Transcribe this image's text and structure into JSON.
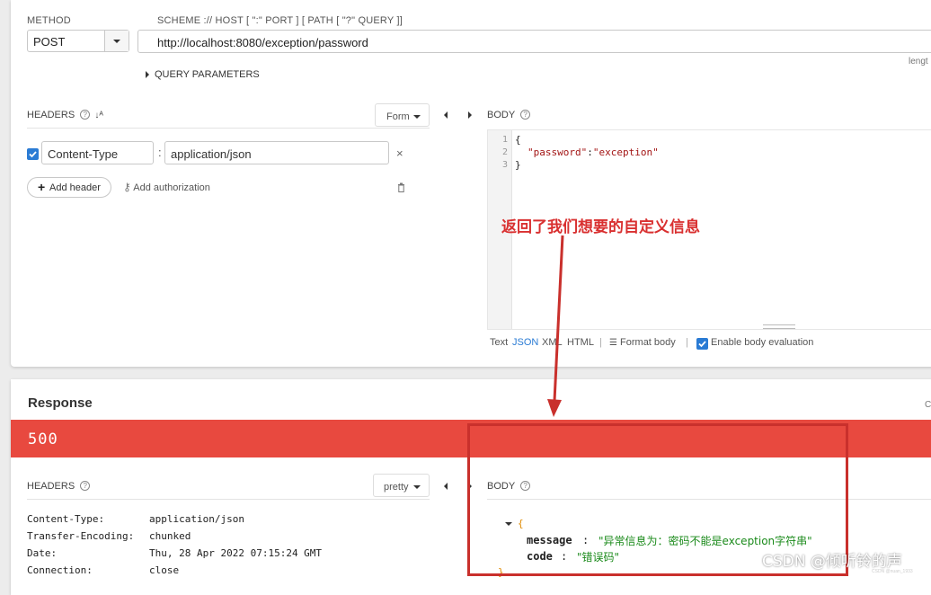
{
  "request": {
    "method_label": "METHOD",
    "method_value": "POST",
    "url_label": "SCHEME :// HOST [ \":\" PORT ] [ PATH [ \"?\" QUERY ]]",
    "url_value": "http://localhost:8080/exception/password",
    "length_label": "lengt",
    "query_parameters_label": "QUERY PARAMETERS",
    "headers_label": "HEADERS",
    "headers_mode": "Form",
    "header_rows": [
      {
        "name": "Content-Type",
        "value": "application/json",
        "enabled": true
      }
    ],
    "add_header_label": "Add header",
    "add_authorization_label": "Add authorization",
    "body_label": "BODY",
    "body_lines": [
      {
        "no": "1",
        "text": "{"
      },
      {
        "no": "2",
        "key": "\"password\"",
        "sep": ":",
        "val": "\"exception\""
      },
      {
        "no": "3",
        "text": "}"
      }
    ],
    "body_modes": [
      "Text",
      "JSON",
      "XML",
      "HTML"
    ],
    "active_body_mode": "JSON",
    "format_body_label": "Format body",
    "enable_body_evaluation_label": "Enable body evaluation"
  },
  "annotation_text": "返回了我们想要的自定义信息",
  "response": {
    "title": "Response",
    "right_edge_char": "C",
    "status_code": "500",
    "status_color": "#e8493f",
    "headers_label": "HEADERS",
    "headers_mode": "pretty",
    "body_label": "BODY",
    "header_rows": [
      {
        "name": "Content-Type:",
        "value": "application/json"
      },
      {
        "name": "Transfer-Encoding:",
        "value": "chunked"
      },
      {
        "name": "Date:",
        "value": "Thu, 28 Apr 2022 07:15:24 GMT"
      },
      {
        "name": "Connection:",
        "value": "close"
      }
    ],
    "body_open": "{",
    "body_close": "}",
    "body_fields": [
      {
        "key": "message",
        "value": "\"异常信息为：密码不能是exception字符串\""
      },
      {
        "key": "code",
        "value": "\"错误码\""
      }
    ]
  },
  "watermark": "CSDN @倾听铃的声",
  "watermark_small": "CSDN @nuan_1933"
}
